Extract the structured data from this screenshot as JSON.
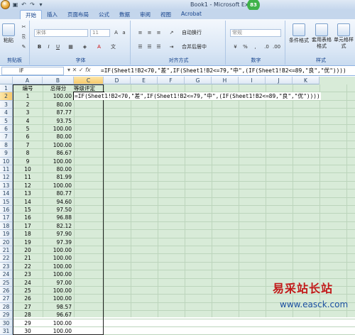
{
  "window": {
    "title": "Book1 - Microsoft Excel",
    "badge": "83"
  },
  "tabs": [
    "开始",
    "插入",
    "页面布局",
    "公式",
    "数据",
    "审阅",
    "视图",
    "Acrobat"
  ],
  "ribbon": {
    "clipboard": {
      "label": "剪贴板",
      "paste": "粘贴"
    },
    "font": {
      "label": "字体",
      "font_name": "宋体",
      "font_size": "11"
    },
    "alignment": {
      "label": "对齐方式",
      "wrap": "自动换行",
      "merge": "合并后居中"
    },
    "number": {
      "label": "数字",
      "format": "常规"
    },
    "styles": {
      "label": "样式",
      "conditional": "条件格式",
      "table": "套用表格格式",
      "cell": "单元格样式"
    }
  },
  "formula_bar": {
    "name_box": "IF",
    "formula": "=IF(Sheet1!B2<70,\"差\",IF(Sheet1!B2<=79,\"中\",(IF(Sheet1!B2<=89,\"良\",\"优\"))))"
  },
  "columns": [
    "A",
    "B",
    "C",
    "D",
    "E",
    "F",
    "G",
    "H",
    "I",
    "J",
    "K"
  ],
  "headers": {
    "a": "编号",
    "b": "总得分",
    "c": "等级评定"
  },
  "rows": [
    {
      "id": "1",
      "score": "100.00"
    },
    {
      "id": "2",
      "score": "80.00"
    },
    {
      "id": "3",
      "score": "87.77"
    },
    {
      "id": "4",
      "score": "93.75"
    },
    {
      "id": "5",
      "score": "100.00"
    },
    {
      "id": "6",
      "score": "80.00"
    },
    {
      "id": "7",
      "score": "100.00"
    },
    {
      "id": "8",
      "score": "86.67"
    },
    {
      "id": "9",
      "score": "100.00"
    },
    {
      "id": "10",
      "score": "80.00"
    },
    {
      "id": "11",
      "score": "81.99"
    },
    {
      "id": "12",
      "score": "100.00"
    },
    {
      "id": "13",
      "score": "80.77"
    },
    {
      "id": "14",
      "score": "94.60"
    },
    {
      "id": "15",
      "score": "97.50"
    },
    {
      "id": "16",
      "score": "96.88"
    },
    {
      "id": "17",
      "score": "82.12"
    },
    {
      "id": "18",
      "score": "97.90"
    },
    {
      "id": "19",
      "score": "97.39"
    },
    {
      "id": "20",
      "score": "100.00"
    },
    {
      "id": "21",
      "score": "100.00"
    },
    {
      "id": "22",
      "score": "100.00"
    },
    {
      "id": "23",
      "score": "100.00"
    },
    {
      "id": "24",
      "score": "97.00"
    },
    {
      "id": "25",
      "score": "100.00"
    },
    {
      "id": "26",
      "score": "100.00"
    },
    {
      "id": "27",
      "score": "98.57"
    },
    {
      "id": "28",
      "score": "96.67"
    },
    {
      "id": "29",
      "score": "100.00"
    },
    {
      "id": "30",
      "score": "100.00"
    }
  ],
  "editing_text": "=IF(Sheet1!B2<70,\"差\",IF(Sheet1!B2<=79,\"中\",(IF(Sheet1!B2<=89,\"良\",\"优\"))))",
  "watermark": {
    "text": "易采站长站",
    "url": "www.easck.com"
  }
}
